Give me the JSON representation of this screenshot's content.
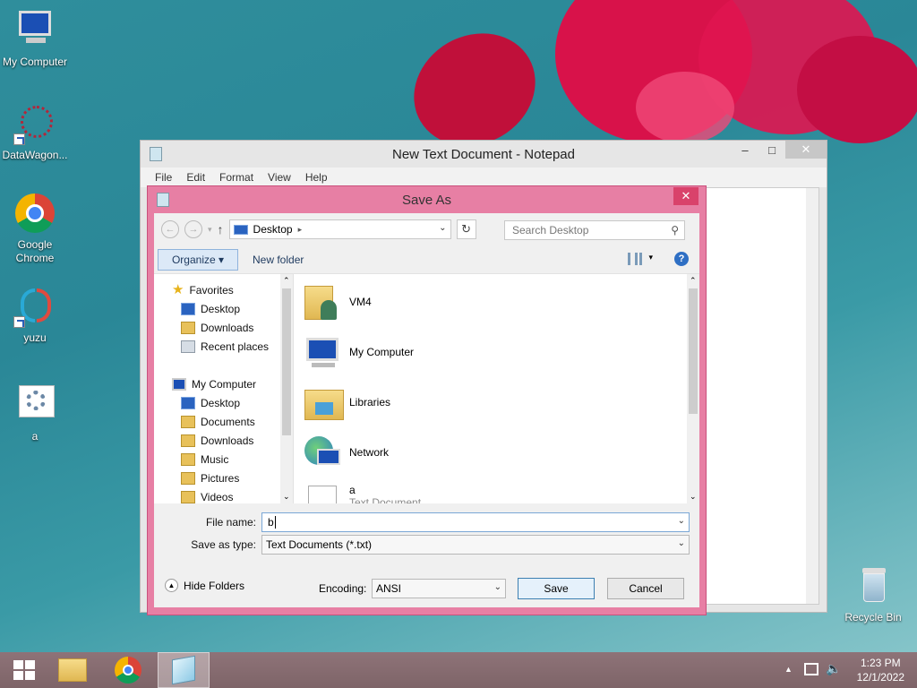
{
  "desktop": {
    "icons": [
      {
        "label": "My Computer"
      },
      {
        "label": "DataWagon..."
      },
      {
        "label": "Google Chrome"
      },
      {
        "label": "yuzu"
      },
      {
        "label": "a"
      },
      {
        "label": "Recycle Bin"
      }
    ]
  },
  "notepad": {
    "title": "New Text Document - Notepad",
    "menu": [
      "File",
      "Edit",
      "Format",
      "View",
      "Help"
    ],
    "controls": {
      "minimize": "–",
      "maximize": "□",
      "close": "✕"
    }
  },
  "save_dialog": {
    "title": "Save As",
    "close": "✕",
    "address": "Desktop",
    "search_placeholder": "Search Desktop",
    "organize": "Organize ▾",
    "new_folder": "New folder",
    "nav": {
      "favorites": "Favorites",
      "favorite_items": [
        "Desktop",
        "Downloads",
        "Recent places"
      ],
      "computer": "My Computer",
      "computer_items": [
        "Desktop",
        "Documents",
        "Downloads",
        "Music",
        "Pictures",
        "Videos"
      ]
    },
    "files": [
      {
        "name": "VM4",
        "icon": "user-folder-icon"
      },
      {
        "name": "My Computer",
        "icon": "computer-icon"
      },
      {
        "name": "Libraries",
        "icon": "libraries-icon"
      },
      {
        "name": "Network",
        "icon": "network-icon"
      },
      {
        "name": "a",
        "sub": "Text Document",
        "icon": "text-document-icon"
      }
    ],
    "file_name_label": "File name:",
    "file_name_value": "b",
    "save_type_label": "Save as type:",
    "save_type_value": "Text Documents (*.txt)",
    "hide_folders": "Hide Folders",
    "encoding_label": "Encoding:",
    "encoding_value": "ANSI",
    "save_button": "Save",
    "cancel_button": "Cancel"
  },
  "taskbar": {
    "time": "1:23 PM",
    "date": "12/1/2022"
  },
  "colors": {
    "dialog_frame": "#e77fa4",
    "dialog_close": "#d9426b",
    "desktop_bg": "#2f8e9c"
  }
}
